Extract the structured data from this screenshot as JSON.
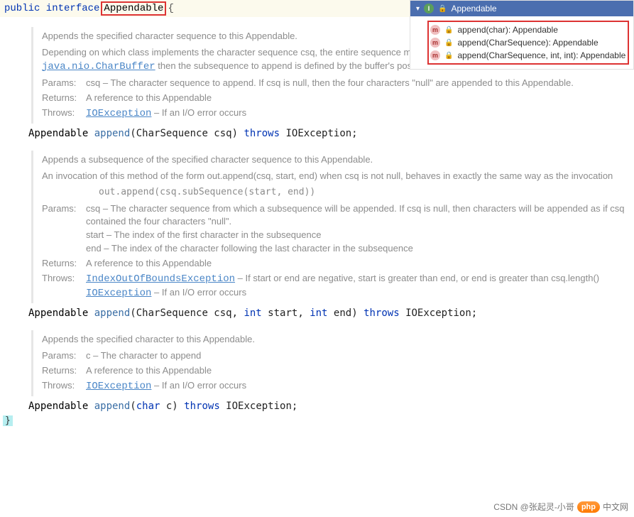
{
  "code": {
    "first_line_pre": "public interface",
    "interface_name": "Appendable",
    "first_line_post": "{",
    "close_brace": "}"
  },
  "docs": [
    {
      "main1": "Appends the specified character sequence to this Appendable.",
      "main2_a": "Depending on which class implements the character sequence csq, the entire sequence may not be appended. For instance, if csq is a ",
      "main2_link": "java.nio.CharBuffer",
      "main2_b": " then the subsequence to append is defined by the buffer's position and limit.",
      "params": "csq – The character sequence to append. If csq is null, then the four characters \"null\" are appended to this Appendable.",
      "returns": "A reference to this Appendable",
      "throws": [
        {
          "ex": "IOException",
          "desc": " – If an I/O error occurs"
        }
      ],
      "sig_ret": "Appendable ",
      "sig_m": "append",
      "sig_rest": "(CharSequence csq) ",
      "sig_kw": "throws",
      "sig_after": " IOException;"
    },
    {
      "main1": "Appends a subsequence of the specified character sequence to this Appendable.",
      "main2_a": "An invocation of this method of the form out.append(csq, start, end) when csq is not null, behaves in exactly the same way as the invocation",
      "main2_code": "out.append(csq.subSequence(start, end))",
      "params": "csq – The character sequence from which a subsequence will be appended. If csq is null, then characters will be appended as if csq contained the four characters \"null\".\nstart – The index of the first character in the subsequence\nend – The index of the character following the last character in the subsequence",
      "returns": "A reference to this Appendable",
      "throws": [
        {
          "ex": "IndexOutOfBoundsException",
          "desc": " – If start or end are negative, start is greater than end, or end is greater than csq.length()"
        },
        {
          "ex": "IOException",
          "desc": " – If an I/O error occurs"
        }
      ],
      "sig_ret": "Appendable ",
      "sig_m": "append",
      "sig_rest1": "(CharSequence csq, ",
      "sig_kw_int1": "int",
      "sig_rest2": " start, ",
      "sig_kw_int2": "int",
      "sig_rest3": " end) ",
      "sig_kw": "throws",
      "sig_after": " IOException;"
    },
    {
      "main1": "Appends the specified character to this Appendable.",
      "params": "c – The character to append",
      "returns": "A reference to this Appendable",
      "throws": [
        {
          "ex": "IOException",
          "desc": " – If an I/O error occurs"
        }
      ],
      "sig_ret": "Appendable ",
      "sig_m": "append",
      "sig_rest1": "(",
      "sig_kw_char": "char",
      "sig_rest2": " c) ",
      "sig_kw": "throws",
      "sig_after": " IOException;"
    }
  ],
  "labels": {
    "params": "Params:",
    "returns": "Returns:",
    "throws": "Throws:"
  },
  "outline": {
    "title": "Appendable",
    "items": [
      "append(char): Appendable",
      "append(CharSequence): Appendable",
      "append(CharSequence, int, int): Appendable"
    ]
  },
  "watermark": {
    "left": "CSDN @张起灵-小哥",
    "badge": "php",
    "right": "中文网"
  }
}
